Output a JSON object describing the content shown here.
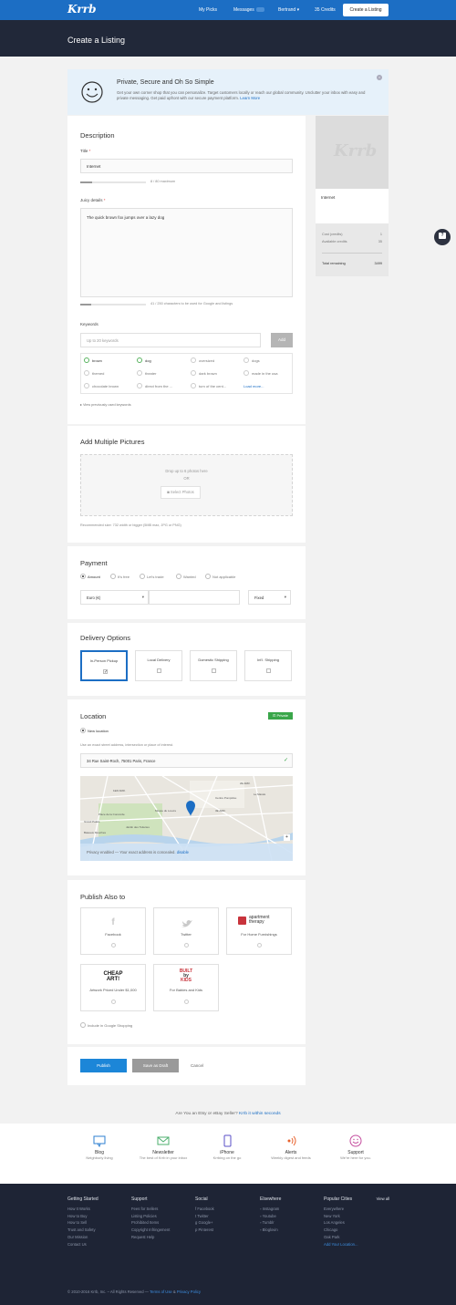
{
  "nav": {
    "logo": "Krrb",
    "my_picks": "My Picks",
    "messages": "Messages",
    "user": "Bertrand",
    "credits": "35 Credits",
    "create": "Create a Listing"
  },
  "page_title": "Create a Listing",
  "banner": {
    "title": "Private, Secure and Oh So Simple",
    "text": "Get your own corner shop that you can personalize. Target customers locally or reach our global community. Unclutter your inbox with easy and private messaging. Get paid upfront with our secure payment platform.",
    "link": "Learn More"
  },
  "description": {
    "heading": "Description",
    "title_label": "Title",
    "title_value": "Internet",
    "title_count": "8 / 80 maximum",
    "details_label": "Juicy details",
    "details_value": "The quick brown fox jumps over a lazy dog",
    "details_count": "41 / 250 characters to be used for Google and listings"
  },
  "keywords": {
    "label": "Keywords",
    "placeholder": "Up to 20 keywords",
    "add": "Add",
    "items": [
      "brown",
      "dog",
      "oversized",
      "dogs",
      "themed",
      "theater",
      "dark brown",
      "made in the usa",
      "chocolate brown",
      "direct from the ...",
      "turn of the cent..."
    ],
    "more": "Load more...",
    "view_prev": "View previously used keywords"
  },
  "pictures": {
    "heading": "Add Multiple Pictures",
    "drop": "Drop up to 6 photos here",
    "or": "OR",
    "select": "Select Photos",
    "note": "Recommended size: 732 width or bigger (5MB max, JPG or PNG)"
  },
  "payment": {
    "heading": "Payment",
    "options": [
      "Amount",
      "It's free",
      "Let's trade",
      "Wanted",
      "Not applicable"
    ],
    "currency": "Euro (€)",
    "type": "Fixed"
  },
  "delivery": {
    "heading": "Delivery Options",
    "options": [
      "In-Person Pickup",
      "Local Delivery",
      "Domestic Shipping",
      "Int'l. Shipping"
    ]
  },
  "location": {
    "heading": "Location",
    "badge": "Private",
    "new_loc": "New location",
    "hint": "Use an exact street address, intersection or place of interest.",
    "address": "34 Rue Saint-Roch, 75001 Paris, France",
    "privacy": "Privacy enabled — Your exact address is concealed.",
    "disable": "disable"
  },
  "map_labels": [
    "1ER ARR.",
    "2E ARR.",
    "Musée du Louvre",
    "Grand Palais",
    "Jardin des Tuileries",
    "Le Marais",
    "Centre Pompidou",
    "Bateaux Mouches",
    "3E ARR.",
    "Place de la Concorde"
  ],
  "publish": {
    "heading": "Publish Also to",
    "cards": [
      "Facebook",
      "Twitter",
      "For Home Furnishings",
      "Artwork Priced Under $1,000",
      "For Babies and Kids"
    ],
    "at_word": "apartment",
    "at_word2": "therapy",
    "cheap": "CHEAP",
    "art": "ART!",
    "built1": "BUILT",
    "built2": "by",
    "built3": "KIDS",
    "google": "Include in Google Shopping"
  },
  "actions": {
    "publish": "Publish",
    "draft": "Save as Draft",
    "cancel": "Cancel"
  },
  "preview": {
    "logo": "Krrb",
    "name": "Internet",
    "cost_label": "Cost (credits)",
    "cost": "1",
    "avail_label": "Available credits",
    "avail": "35",
    "total_label": "Total remaining",
    "total": "3499"
  },
  "etsy": {
    "text": "Are You an Etsy or eBay Seller?",
    "link": "Krrb it within seconds"
  },
  "features": [
    {
      "title": "Blog",
      "sub": "Neighborly living"
    },
    {
      "title": "Newsletter",
      "sub": "The best of Krrb in your inbox"
    },
    {
      "title": "iPhone",
      "sub": "Krrbing on the go"
    },
    {
      "title": "Alerts",
      "sub": "Weekly digest and feeds"
    },
    {
      "title": "Support",
      "sub": "We're here for you."
    }
  ],
  "footer": {
    "getting_started": {
      "title": "Getting Started",
      "items": [
        "How It Works",
        "How to Buy",
        "How to Sell",
        "Trust and Safety",
        "Our Mission",
        "Contact Us"
      ]
    },
    "support": {
      "title": "Support",
      "items": [
        "Fees for Sellers",
        "Listing Policies",
        "Prohibited Items",
        "Copyright Infringement",
        "Request Help"
      ]
    },
    "social": {
      "title": "Social",
      "items": [
        "Facebook",
        "Twitter",
        "Google+",
        "Pinterest"
      ]
    },
    "elsewhere": {
      "title": "Elsewhere",
      "items": [
        "Instagram",
        "Youtube",
        "Tumblr",
        "Bloglovin"
      ]
    },
    "cities": {
      "title": "Popular Cities",
      "view_all": "View all",
      "items": [
        "Everywhere",
        "New York",
        "Los Angeles",
        "Chicago",
        "Oak Park",
        "Add Your Location..."
      ]
    },
    "copyright": "© 2010-2016 Krrb, Inc. – All Rights Reserved —",
    "terms": "Terms of Use",
    "amp": "&",
    "privacy": "Privacy Policy"
  },
  "colors": {
    "brand": "#1c6ec4",
    "header": "#212839",
    "footer": "#1e2435",
    "green": "#3aa64a"
  }
}
